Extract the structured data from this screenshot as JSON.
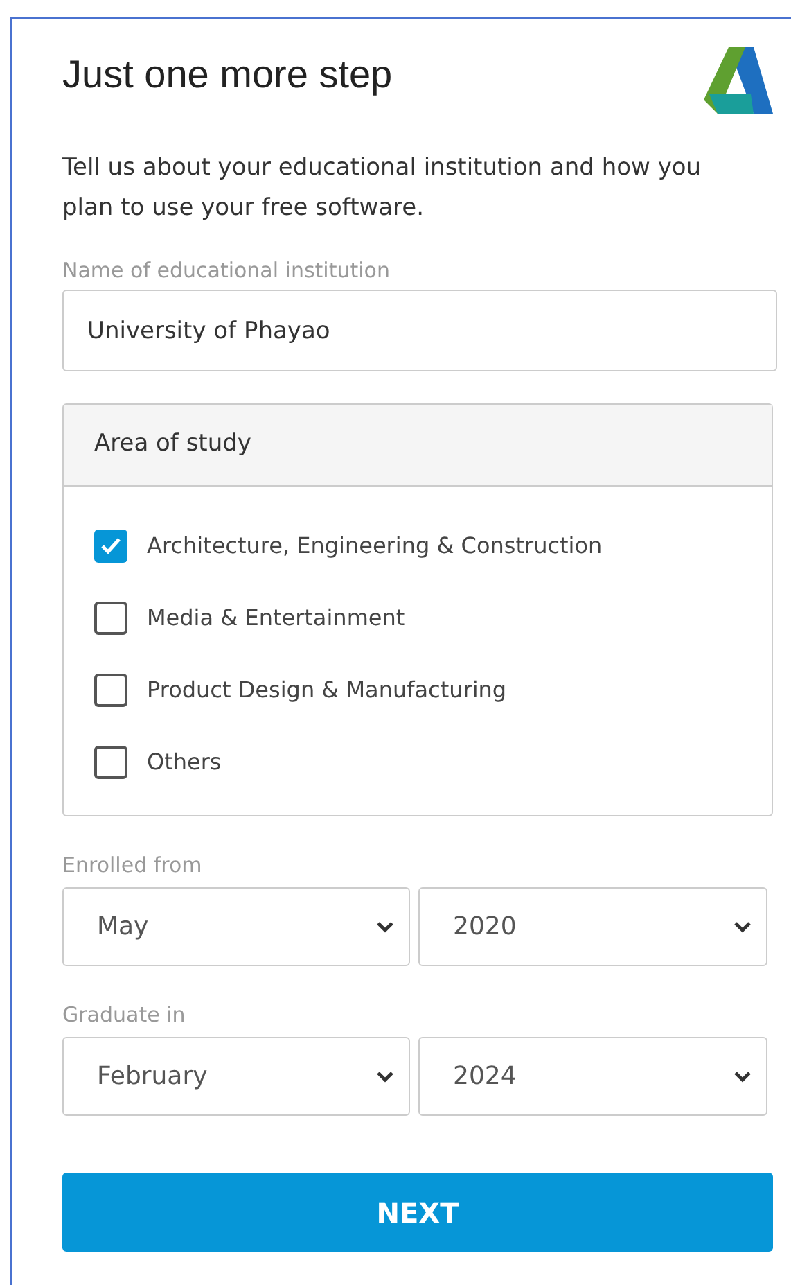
{
  "title": "Just one more step",
  "description": "Tell us about your educational institution and how you plan to use your free software.",
  "institution": {
    "label": "Name of educational institution",
    "value": "University of Phayao"
  },
  "area_of_study": {
    "heading": "Area of study",
    "options": [
      {
        "label": "Architecture, Engineering & Construction",
        "checked": true
      },
      {
        "label": "Media & Entertainment",
        "checked": false
      },
      {
        "label": "Product Design & Manufacturing",
        "checked": false
      },
      {
        "label": "Others",
        "checked": false
      }
    ]
  },
  "date_groups": [
    {
      "label": "Enrolled from",
      "month": "May",
      "year": "2020"
    },
    {
      "label": "Graduate in",
      "month": "February",
      "year": "2024"
    }
  ],
  "next_button": "NEXT"
}
